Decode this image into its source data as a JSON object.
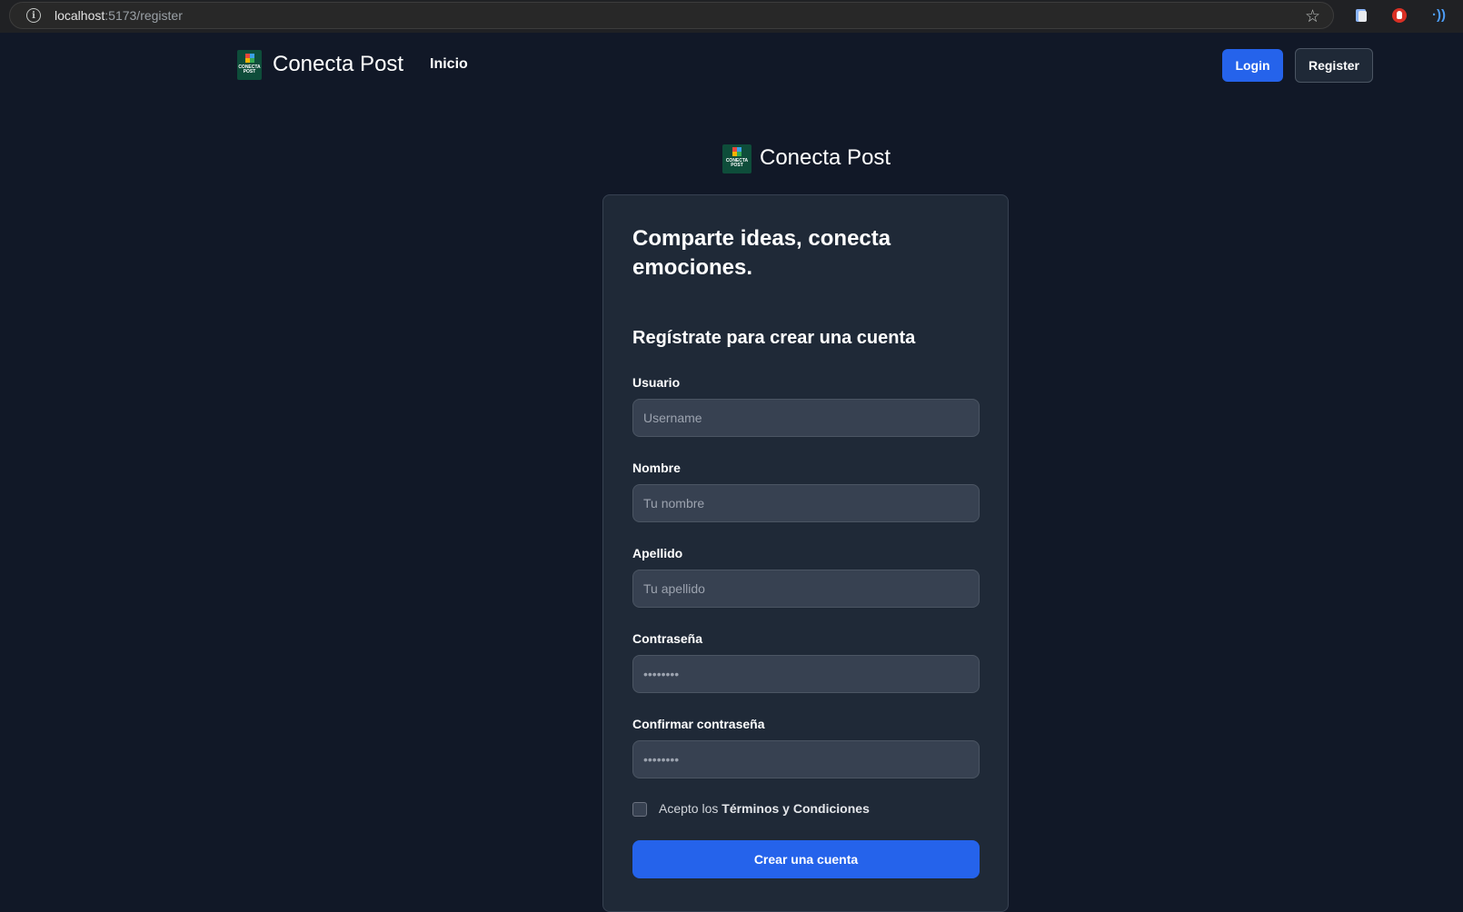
{
  "browser": {
    "url_host": "localhost",
    "url_rest": ":5173/register"
  },
  "navbar": {
    "logo_text": "CONECTA POST",
    "brand": "Conecta Post",
    "home_link": "Inicio",
    "login_label": "Login",
    "register_label": "Register"
  },
  "header": {
    "brand": "Conecta Post"
  },
  "form": {
    "title": "Comparte ideas, conecta emociones.",
    "subtitle": "Regístrate para crear una cuenta",
    "fields": [
      {
        "label": "Usuario",
        "placeholder": "Username",
        "value": ""
      },
      {
        "label": "Nombre",
        "placeholder": "Tu nombre",
        "value": ""
      },
      {
        "label": "Apellido",
        "placeholder": "Tu apellido",
        "value": ""
      },
      {
        "label": "Contraseña",
        "placeholder": "••••••••",
        "value": ""
      },
      {
        "label": "Confirmar contraseña",
        "placeholder": "••••••••",
        "value": ""
      }
    ],
    "terms_prefix": "Acepto los",
    "terms_link": "Términos y Condiciones",
    "terms_checked": false,
    "submit_label": "Crear una cuenta"
  },
  "colors": {
    "background": "#111827",
    "card": "#1f2937",
    "input": "#374151",
    "accent": "#2563eb"
  }
}
